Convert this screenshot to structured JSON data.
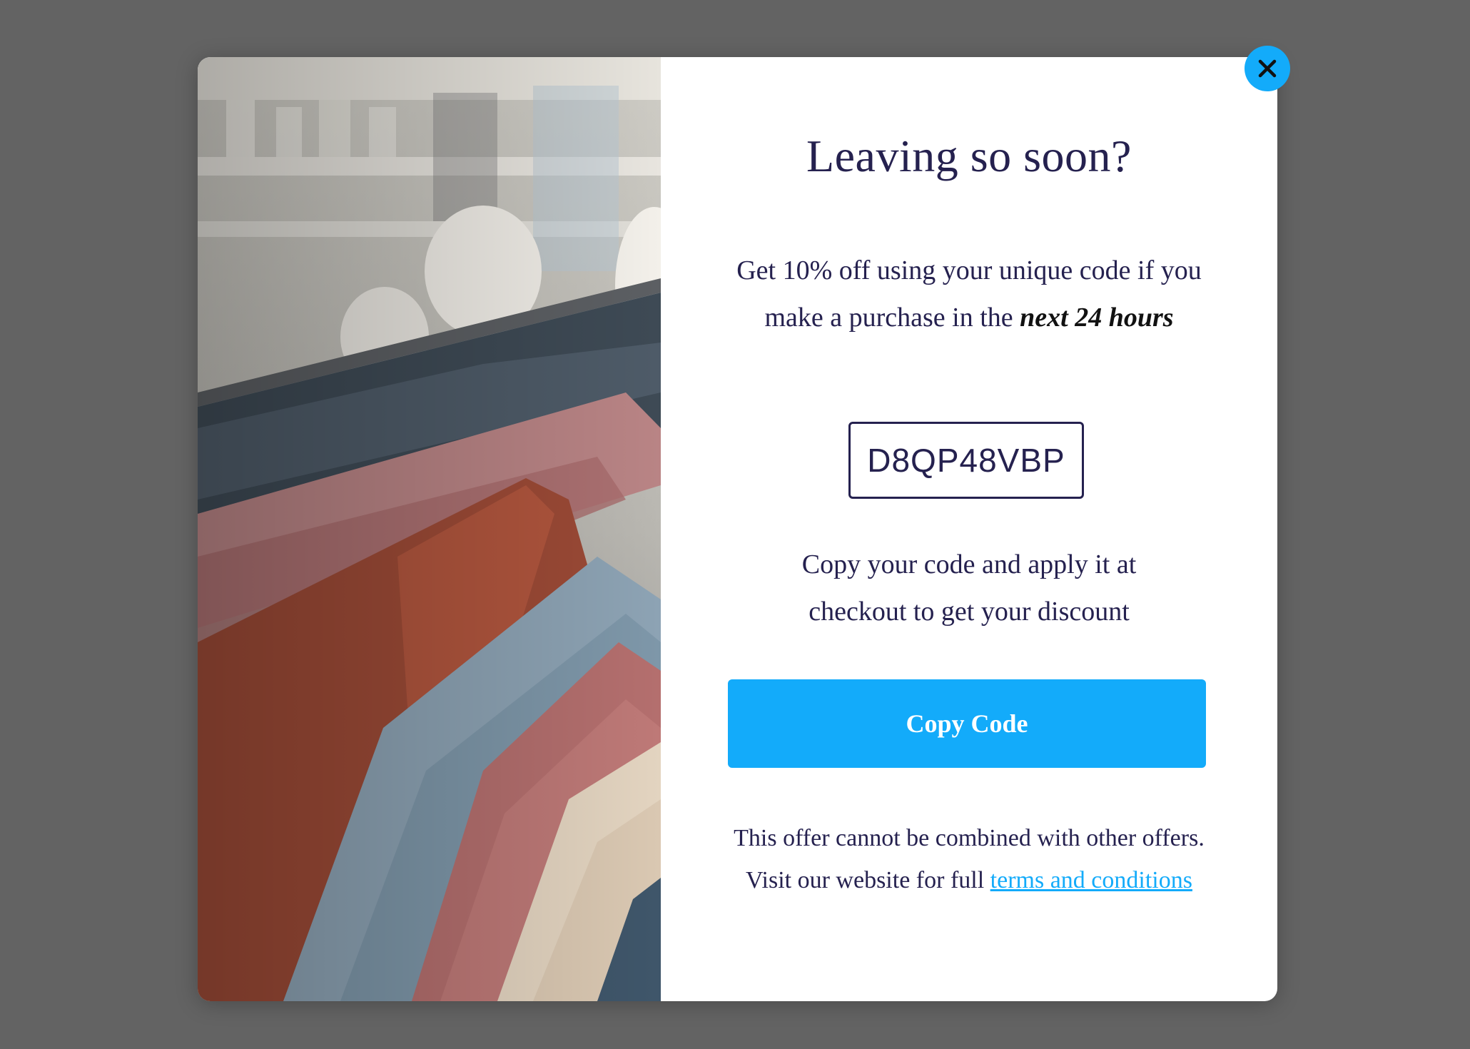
{
  "popup": {
    "headline": "Leaving so soon?",
    "offer_text": "Get 10% off using your unique code if you make a purchase in the ",
    "offer_emphasis": "next 24 hours",
    "discount_code": "D8QP48VBP",
    "instructions": "Copy your code and apply it at checkout to get your discount",
    "copy_button_label": "Copy Code",
    "disclaimer_text": "This offer cannot be combined with other offers. Visit our website for full ",
    "terms_link_label": "terms and conditions",
    "close_icon": "close-icon",
    "image": "clothing-rack-photo"
  },
  "colors": {
    "accent": "#13abfa",
    "text": "#25214f",
    "backdrop": "#636363",
    "panel": "#ffffff"
  }
}
